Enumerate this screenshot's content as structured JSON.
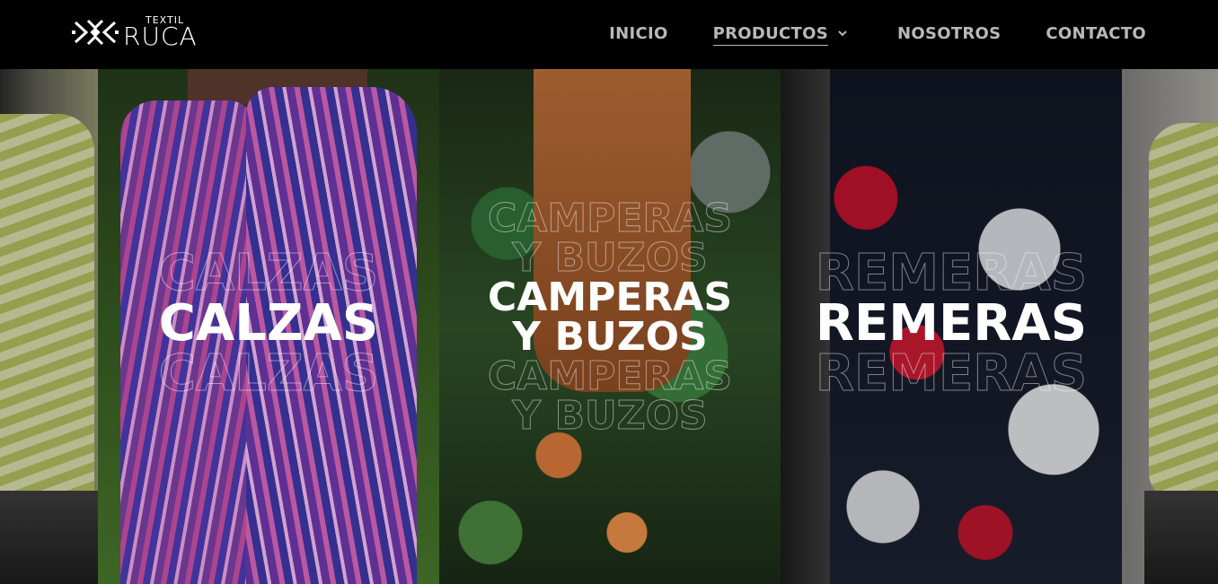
{
  "header": {
    "logo": {
      "small": "TEXTIL",
      "big": "RUCA"
    },
    "nav": [
      {
        "label": "INICIO"
      },
      {
        "label": "PRODUCTOS"
      },
      {
        "label": "NOSOTROS"
      },
      {
        "label": "CONTACTO"
      }
    ]
  },
  "panels": [
    {
      "title": "CALZAS"
    },
    {
      "title_line1": "CAMPERAS",
      "title_line2": "Y BUZOS"
    },
    {
      "title": "REMERAS"
    }
  ],
  "colors": {
    "header_bg": "#000000",
    "nav_text": "#b9b9b9",
    "title": "#ffffff"
  }
}
